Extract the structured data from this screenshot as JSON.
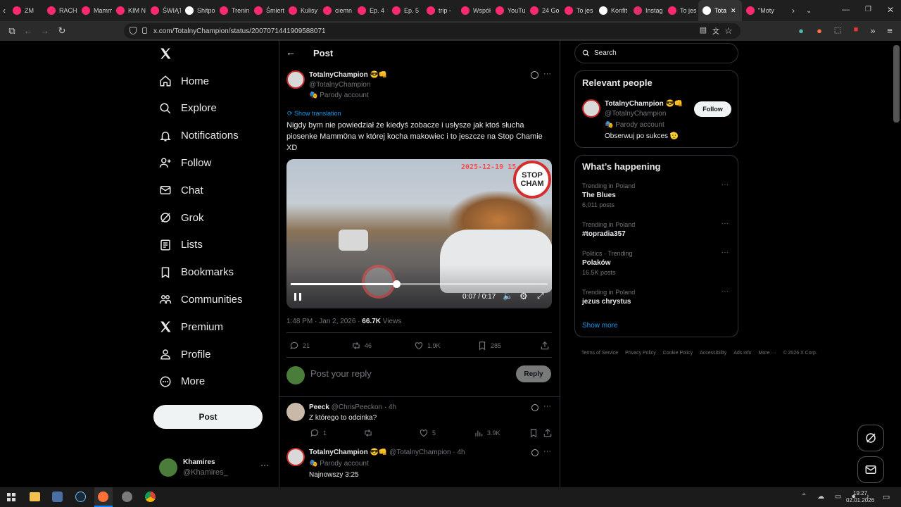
{
  "browser": {
    "tabs": [
      {
        "label": "ZM",
        "color": "#ff2a6d"
      },
      {
        "label": "RACH",
        "color": "#ff2a6d"
      },
      {
        "label": "Mamm",
        "color": "#ff2a6d"
      },
      {
        "label": "KIM N",
        "color": "#ff2a6d"
      },
      {
        "label": "ŚWIĄT",
        "color": "#ff2a6d"
      },
      {
        "label": "Shitpo",
        "color": "#ffffff"
      },
      {
        "label": "Trenin",
        "color": "#ff2a6d"
      },
      {
        "label": "Śmiert",
        "color": "#ff2a6d"
      },
      {
        "label": "Kulisy",
        "color": "#ff2a6d"
      },
      {
        "label": "ciemn",
        "color": "#ff2a6d"
      },
      {
        "label": "Ep. 4",
        "color": "#ff2a6d"
      },
      {
        "label": "Ep. 5",
        "color": "#ff2a6d"
      },
      {
        "label": "trip -",
        "color": "#ff2a6d"
      },
      {
        "label": "Współ",
        "color": "#ff2a6d"
      },
      {
        "label": "YouTu",
        "color": "#ff2a6d"
      },
      {
        "label": "24 Go",
        "color": "#ff2a6d"
      },
      {
        "label": "To jes",
        "color": "#ff2a6d"
      },
      {
        "label": "Konfit",
        "color": "#ffffff"
      },
      {
        "label": "Instag",
        "color": "#e1306c"
      },
      {
        "label": "To jes",
        "color": "#ff2a6d"
      },
      {
        "label": "Tota",
        "color": "#ffffff"
      },
      {
        "label": "\"Moty",
        "color": "#ff2a6d"
      }
    ],
    "url": "x.com/TotalnyChampion/status/2007071441909588071"
  },
  "sidebar": {
    "items": [
      {
        "label": "Home",
        "icon": "home-icon"
      },
      {
        "label": "Explore",
        "icon": "search-icon"
      },
      {
        "label": "Notifications",
        "icon": "bell-icon"
      },
      {
        "label": "Follow",
        "icon": "follow-icon"
      },
      {
        "label": "Chat",
        "icon": "mail-icon"
      },
      {
        "label": "Grok",
        "icon": "grok-icon"
      },
      {
        "label": "Lists",
        "icon": "list-icon"
      },
      {
        "label": "Bookmarks",
        "icon": "bookmark-icon"
      },
      {
        "label": "Communities",
        "icon": "communities-icon"
      },
      {
        "label": "Premium",
        "icon": "x-icon"
      },
      {
        "label": "Profile",
        "icon": "person-icon"
      },
      {
        "label": "More",
        "icon": "more-icon"
      }
    ],
    "post_button": "Post",
    "account": {
      "name": "Khamires",
      "handle": "@Khamires_"
    }
  },
  "header": {
    "title": "Post"
  },
  "post": {
    "author_name": "TotalnyChampion 😎👊",
    "handle": "@TotalnyChampion",
    "badge": "Parody account",
    "show_translation": "Show translation",
    "text": "Nigdy bym nie powiedział że kiedyś zobacze i usłysze jak ktoś słucha piosenke Mamm0na w której kocha makowiec i to jeszcze na Stop Chamie XD",
    "video": {
      "timestamp_overlay": "2025-12-19 15",
      "sign_text_1": "STOP",
      "sign_text_2": "CHAM",
      "time": "0:07 / 0:17",
      "progress": 0.41
    },
    "meta_time": "1:48 PM · Jan 2, 2026 ·",
    "views_count": "66.7K",
    "views_label": "Views",
    "stats": {
      "replies": "21",
      "reposts": "46",
      "likes": "1.9K",
      "bookmarks": "285"
    },
    "reply_placeholder": "Post your reply",
    "reply_button": "Reply"
  },
  "replies": [
    {
      "name": "Peeck",
      "handle": "@ChrisPeeckon · 4h",
      "text": "Z którego to odcinka?",
      "replies": "1",
      "likes": "5",
      "views": "3.9K"
    },
    {
      "name": "TotalnyChampion 😎👊",
      "handle": "@TotalnyChampion · 4h",
      "badge": "Parody account",
      "text": "Najnowszy 3:25"
    }
  ],
  "right": {
    "search_placeholder": "Search",
    "relevant_title": "Relevant people",
    "person": {
      "name": "TotalnyChampion 😎👊",
      "handle": "@TotalnyChampion",
      "badge": "Parody account",
      "bio": "Obserwuj po sukces 🫡",
      "follow": "Follow"
    },
    "happening_title": "What’s happening",
    "trends": [
      {
        "context": "Trending in Poland",
        "name": "The Blues",
        "count": "6,011 posts"
      },
      {
        "context": "Trending in Poland",
        "name": "#topradia357",
        "count": ""
      },
      {
        "context": "Politics · Trending",
        "name": "Polaków",
        "count": "16.5K posts"
      },
      {
        "context": "Trending in Poland",
        "name": "jezus chrystus",
        "count": ""
      }
    ],
    "show_more": "Show more",
    "footer": [
      "Terms of Service",
      "Privacy Policy",
      "Cookie Policy",
      "Accessibility",
      "Ads info",
      "More ···",
      "© 2026 X Corp."
    ]
  },
  "taskbar": {
    "time": "19:27",
    "date": "02.01.2026"
  }
}
